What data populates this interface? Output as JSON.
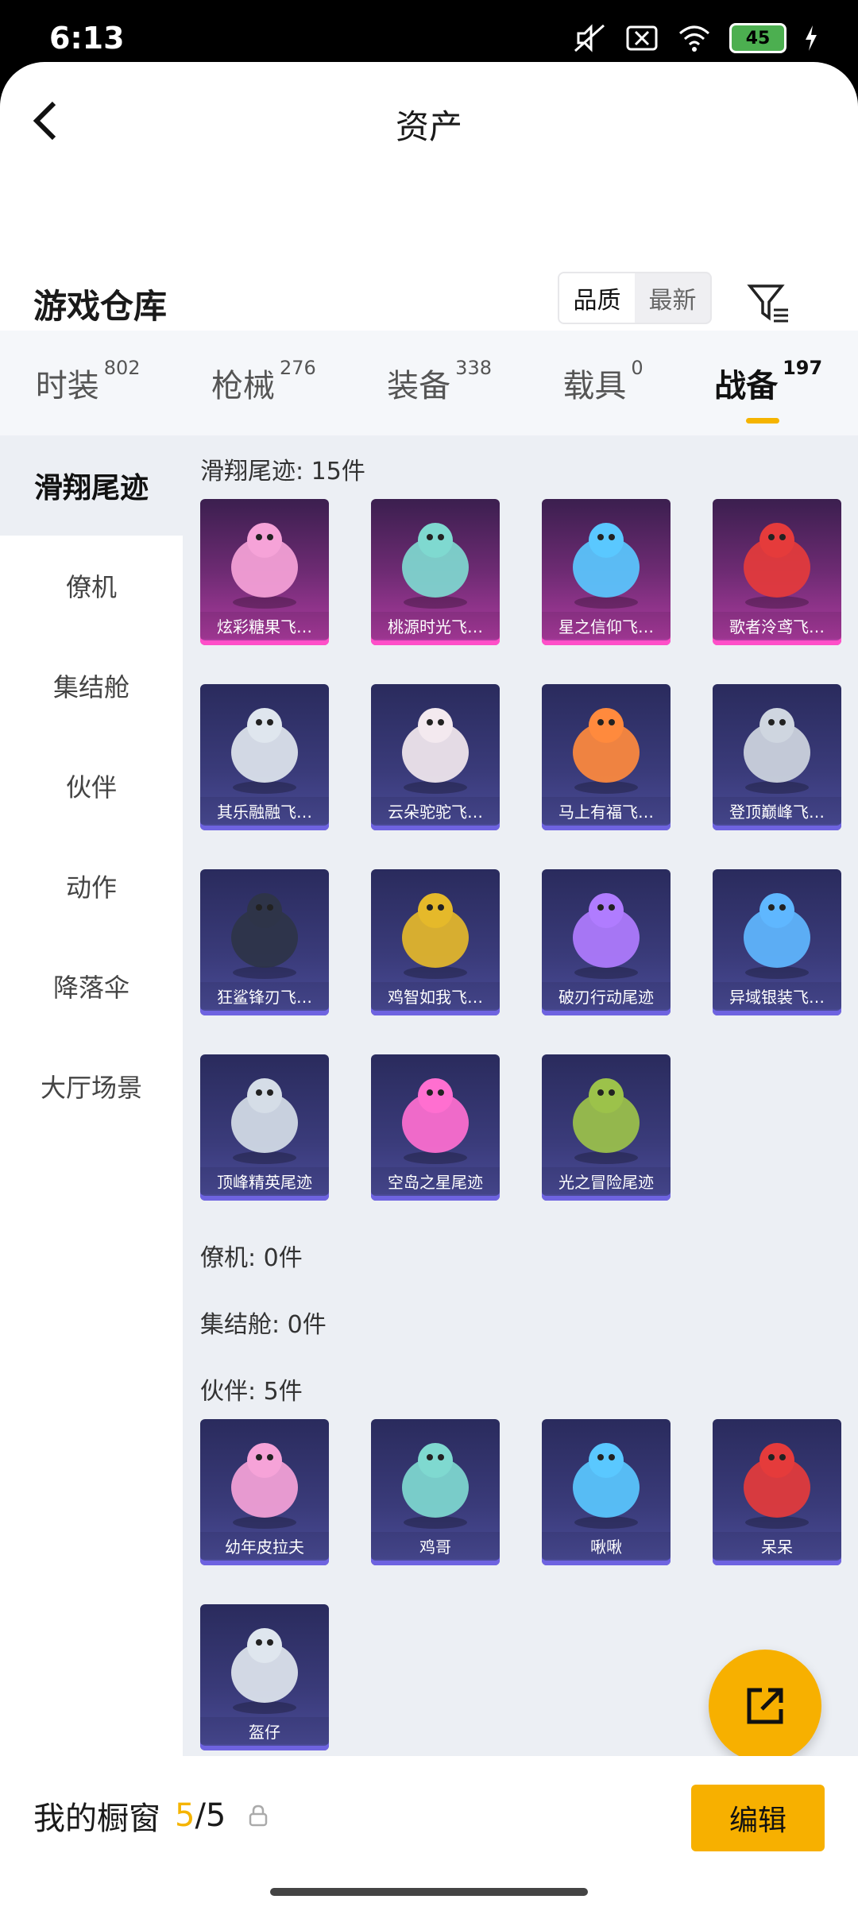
{
  "status": {
    "time": "6:13",
    "battery": "45"
  },
  "header": {
    "title": "资产"
  },
  "inventory": {
    "title": "游戏仓库",
    "sort": {
      "options": [
        "品质",
        "最新"
      ],
      "active_index": 0
    }
  },
  "categories": [
    {
      "label": "时装",
      "count": "802"
    },
    {
      "label": "枪械",
      "count": "276"
    },
    {
      "label": "装备",
      "count": "338"
    },
    {
      "label": "载具",
      "count": "0"
    },
    {
      "label": "战备",
      "count": "197"
    }
  ],
  "sidebar": [
    {
      "label": "滑翔尾迹"
    },
    {
      "label": "僚机"
    },
    {
      "label": "集结舱"
    },
    {
      "label": "伙伴"
    },
    {
      "label": "动作"
    },
    {
      "label": "降落伞"
    },
    {
      "label": "大厅场景"
    }
  ],
  "sections": {
    "glide": {
      "title": "滑翔尾迹: 15件",
      "items": [
        {
          "name": "炫彩糖果飞…",
          "icon": "candy-glider-icon",
          "rarity": "pink"
        },
        {
          "name": "桃源时光飞…",
          "icon": "peach-glider-icon",
          "rarity": "pink"
        },
        {
          "name": "星之信仰飞…",
          "icon": "feather-bow-glider-icon",
          "rarity": "pink"
        },
        {
          "name": "歌者泠鸢飞…",
          "icon": "red-bird-glider-icon",
          "rarity": "pink"
        },
        {
          "name": "其乐融融飞…",
          "icon": "penguin-glider-icon",
          "rarity": "blue"
        },
        {
          "name": "云朵驼驼飞…",
          "icon": "alpaca-glider-icon",
          "rarity": "blue"
        },
        {
          "name": "马上有福飞…",
          "icon": "horse-glider-icon",
          "rarity": "blue"
        },
        {
          "name": "登顶巅峰飞…",
          "icon": "jet-glider-icon",
          "rarity": "blue"
        },
        {
          "name": "狂鲨锋刃飞…",
          "icon": "shark-glider-icon",
          "rarity": "blue"
        },
        {
          "name": "鸡智如我飞…",
          "icon": "chicken-glider-icon",
          "rarity": "blue"
        },
        {
          "name": "破刃行动尾迹",
          "icon": "smoke-trail-icon",
          "rarity": "blue"
        },
        {
          "name": "异域银装飞…",
          "icon": "dragon-glider-icon",
          "rarity": "blue"
        },
        {
          "name": "顶峰精英尾迹",
          "icon": "smoke-trail-icon",
          "rarity": "blue"
        },
        {
          "name": "空岛之星尾迹",
          "icon": "rainbow-trail-icon",
          "rarity": "blue"
        },
        {
          "name": "光之冒险尾迹",
          "icon": "green-trail-icon",
          "rarity": "blue"
        }
      ]
    },
    "wingman": {
      "title": "僚机: 0件"
    },
    "pod": {
      "title": "集结舱: 0件"
    },
    "partner": {
      "title": "伙伴: 5件",
      "items": [
        {
          "name": "幼年皮拉夫",
          "icon": "shark-kid-icon",
          "rarity": "blue"
        },
        {
          "name": "鸡哥",
          "icon": "rooster-icon",
          "rarity": "blue"
        },
        {
          "name": "啾啾",
          "icon": "pink-bird-icon",
          "rarity": "blue"
        },
        {
          "name": "呆呆",
          "icon": "chick-icon",
          "rarity": "blue"
        },
        {
          "name": "盔仔",
          "icon": "helmet-bird-icon",
          "rarity": "blue"
        }
      ]
    }
  },
  "showcase": {
    "title": "我的橱窗",
    "current": "5",
    "total": "/5"
  },
  "edit_label": "编辑"
}
